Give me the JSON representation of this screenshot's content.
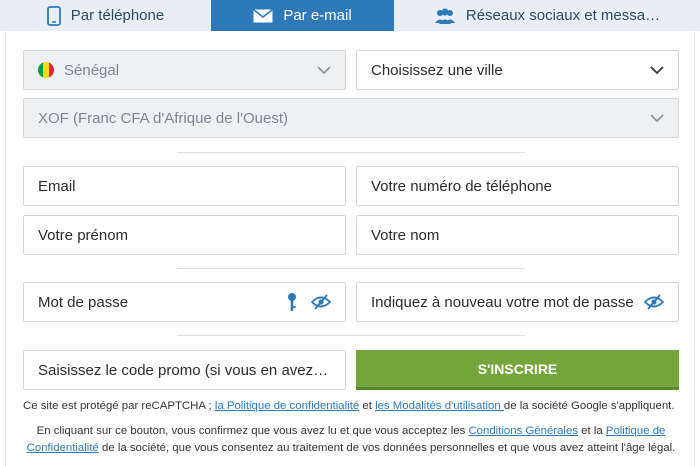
{
  "tabs": [
    {
      "label": "Par téléphone",
      "icon": "phone-icon"
    },
    {
      "label": "Par e-mail",
      "icon": "envelope-icon"
    },
    {
      "label": "Réseaux sociaux et messa…",
      "icon": "users-icon"
    }
  ],
  "form": {
    "country": "Sénégal",
    "city_placeholder": "Choisissez une ville",
    "currency": "XOF (Franc CFA d'Afrique de l'Ouest)",
    "email_placeholder": "Email",
    "phone_placeholder": "Votre numéro de téléphone",
    "firstname_placeholder": "Votre prénom",
    "lastname_placeholder": "Votre nom",
    "password_placeholder": "Mot de passe",
    "password_confirm_placeholder": "Indiquez à nouveau votre mot de passe",
    "promo_placeholder": "Saisissez le code promo (si vous en avez u…",
    "submit_label": "S'INSCRIRE"
  },
  "legal": {
    "recaptcha_1": "Ce site est protégé par reCAPTCHA ; ",
    "privacy_link": "la Politique de confidentialité",
    "recaptcha_2": " et ",
    "terms_link": "les Modalités d'utilisation ",
    "recaptcha_3": "de la société Google s'appliquent.",
    "consent_1": "En cliquant sur ce bouton, vous confirmez que vous avez lu et que vous acceptez les ",
    "conditions_link": "Conditions Générales",
    "consent_2": " et la ",
    "policy_link": "Politique de Confidentialité",
    "consent_3": " de la société, que vous consentez au traitement de vos données personnelles et que vous avez atteint l'âge légal."
  },
  "colors": {
    "accent": "#2e79b7",
    "button": "#76a53c"
  }
}
